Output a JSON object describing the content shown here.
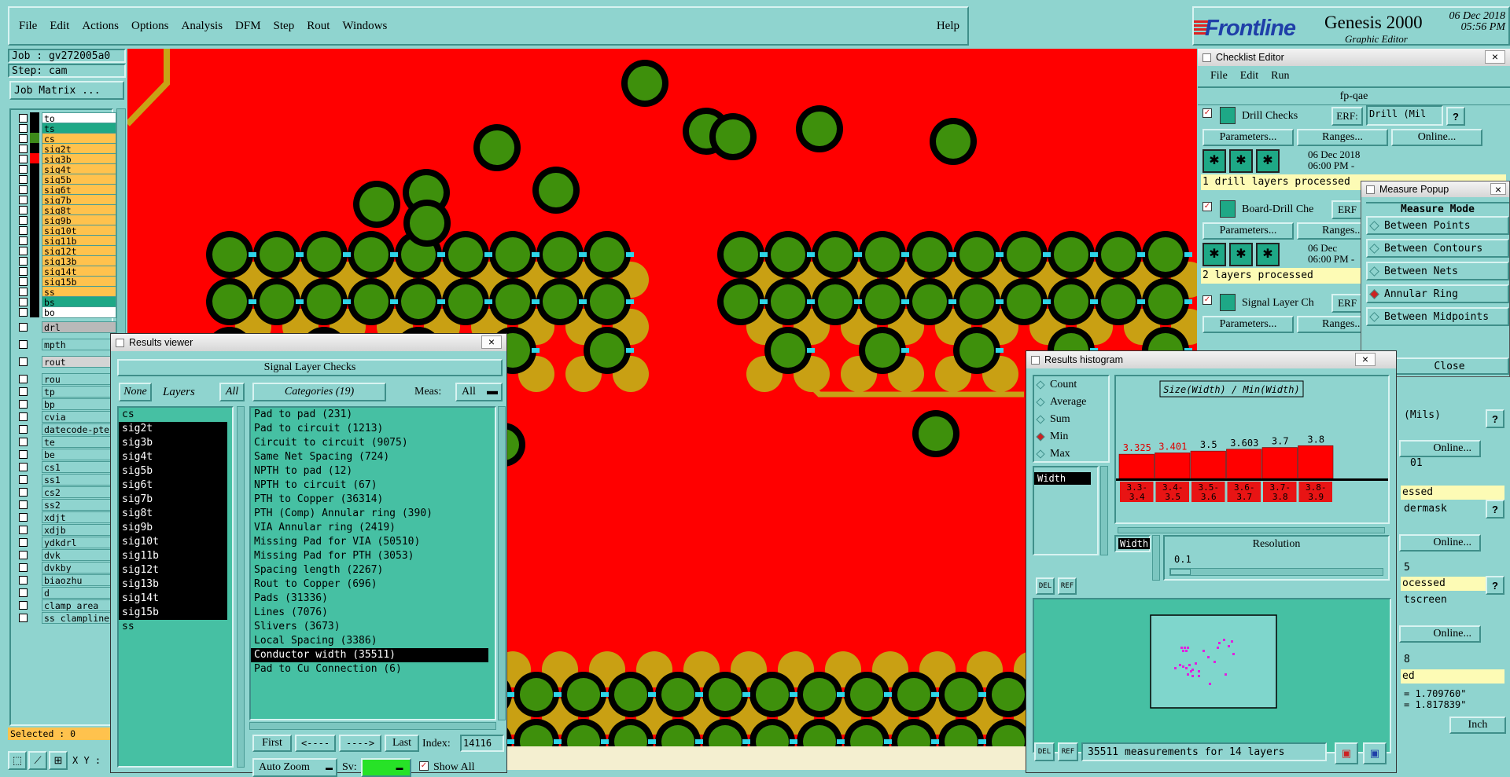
{
  "menubar": {
    "items": [
      "File",
      "Edit",
      "Actions",
      "Options",
      "Analysis",
      "DFM",
      "Step",
      "Rout",
      "Windows"
    ],
    "help": "Help"
  },
  "brand": {
    "logo": "Frontline",
    "product": "Genesis 2000",
    "subtitle": "Graphic Editor",
    "date": "06 Dec 2018",
    "time": "05:56 PM"
  },
  "left": {
    "job": "Job : gv272005a0",
    "step": "Step: cam",
    "job_matrix": "Job Matrix ...",
    "layers": [
      {
        "name": "to",
        "color": "#000000",
        "bg": "#ffffff"
      },
      {
        "name": "ts",
        "color": "#000000",
        "bg": "#1ea886"
      },
      {
        "name": "cs",
        "color": "#3d8a1a",
        "bg": "#ffc24d"
      },
      {
        "name": "sig2t",
        "color": "#000000",
        "bg": "#ffc24d"
      },
      {
        "name": "sig3b",
        "color": "#ff0000",
        "bg": "#ffc24d"
      },
      {
        "name": "sig4t",
        "color": "#000000",
        "bg": "#ffc24d"
      },
      {
        "name": "sig5b",
        "color": "#000000",
        "bg": "#ffc24d"
      },
      {
        "name": "sig6t",
        "color": "#000000",
        "bg": "#ffc24d"
      },
      {
        "name": "sig7b",
        "color": "#000000",
        "bg": "#ffc24d"
      },
      {
        "name": "sig8t",
        "color": "#000000",
        "bg": "#ffc24d"
      },
      {
        "name": "sig9b",
        "color": "#000000",
        "bg": "#ffc24d"
      },
      {
        "name": "sig10t",
        "color": "#000000",
        "bg": "#ffc24d"
      },
      {
        "name": "sig11b",
        "color": "#000000",
        "bg": "#ffc24d"
      },
      {
        "name": "sig12t",
        "color": "#000000",
        "bg": "#ffc24d"
      },
      {
        "name": "sig13b",
        "color": "#000000",
        "bg": "#ffc24d"
      },
      {
        "name": "sig14t",
        "color": "#000000",
        "bg": "#ffc24d"
      },
      {
        "name": "sig15b",
        "color": "#000000",
        "bg": "#ffc24d"
      },
      {
        "name": "ss",
        "color": "#000000",
        "bg": "#ffc24d"
      },
      {
        "name": "bs",
        "color": "#000000",
        "bg": "#1ea886"
      },
      {
        "name": "bo",
        "color": "#000000",
        "bg": "#ffffff"
      }
    ],
    "drill_layers": [
      {
        "name": "drl",
        "bg": "#b9b9b9"
      },
      {
        "name": "mpth",
        "bg": "#8fd4cf"
      }
    ],
    "rout_layers": [
      {
        "name": "rout",
        "bg": "#d4d4d4"
      }
    ],
    "misc_layers": [
      "rou",
      "tp",
      "bp",
      "cvia",
      "datecode-pte",
      "te",
      "be",
      "cs1",
      "ss1",
      "cs2",
      "ss2",
      "xdjt",
      "xdjb",
      "ydkdrl",
      "dvk",
      "dvkby",
      "biaozhu",
      "d",
      "clamp_area",
      "ss_clampline"
    ],
    "selected": "Selected : 0",
    "xy_label": "X Y :"
  },
  "checklist": {
    "title": "Checklist Editor",
    "menu": [
      "File",
      "Edit",
      "Run"
    ],
    "name": "fp-qae",
    "checks": [
      {
        "label": "Drill Checks",
        "erf_label": "ERF:",
        "erf_value": "Drill (Mil",
        "date": "06 Dec 2018",
        "time": "06:00 PM -",
        "status": "1 drill layers processed"
      },
      {
        "label": "Board-Drill Che",
        "erf_label": "ERF",
        "erf_value": "",
        "date": "06 Dec",
        "time": "06:00 PM -",
        "status": "2 layers processed"
      },
      {
        "label": "Signal Layer Ch",
        "erf_label": "ERF",
        "erf_value": "",
        "date": "",
        "time": "",
        "status": ""
      }
    ],
    "params": "Parameters...",
    "ranges": "Ranges...",
    "online": "Online...",
    "help": "?",
    "right_fragments": [
      "(Mils)",
      "Online...",
      "01",
      "essed",
      "dermask",
      "Online...",
      "5",
      "ocessed",
      "tscreen",
      "Online...",
      "8",
      "ed"
    ],
    "coords": {
      "x": "= 1.709760\"",
      "y": "= 1.817839\""
    },
    "units": "Inch"
  },
  "measure": {
    "title": "Measure Popup",
    "header": "Measure Mode",
    "modes": [
      "Between Points",
      "Between Contours",
      "Between Nets",
      "Annular Ring",
      "Between Midpoints"
    ],
    "selected_index": 3,
    "close": "Close"
  },
  "results_viewer": {
    "title": "Results viewer",
    "header": "Signal Layer Checks",
    "none": "None",
    "layers": "Layers",
    "all": "All",
    "categories": "Categories (19)",
    "meas_label": "Meas:",
    "meas_value": "All",
    "layer_list": [
      "cs",
      "sig2t",
      "sig3b",
      "sig4t",
      "sig5b",
      "sig6t",
      "sig7b",
      "sig8t",
      "sig9b",
      "sig10t",
      "sig11b",
      "sig12t",
      "sig13b",
      "sig14t",
      "sig15b",
      "ss"
    ],
    "category_list": [
      "Pad to pad (231)",
      "Pad to circuit (1213)",
      "Circuit to circuit (9075)",
      "Same Net Spacing (724)",
      "NPTH to pad (12)",
      "NPTH to circuit (67)",
      "PTH to Copper (36314)",
      "PTH (Comp) Annular ring (390)",
      "VIA Annular ring (2419)",
      "Missing Pad for VIA (50510)",
      "Missing Pad for PTH (3053)",
      "Spacing length (2267)",
      "Rout to Copper (696)",
      "Pads (31336)",
      "Lines (7076)",
      "Slivers (3673)",
      "Local Spacing (3386)",
      "Conductor width (35511)",
      "Pad to Cu Connection (6)"
    ],
    "selected_category": 17,
    "first": "First",
    "prev": "<----",
    "next": "---->",
    "last": "Last",
    "index_label": "Index:",
    "index_value": "14116",
    "auto_zoom": "Auto Zoom",
    "sv_label": "Sv:",
    "show_all": "Show All"
  },
  "histogram": {
    "title": "Results histogram",
    "stat_options": [
      "Count",
      "Average",
      "Sum",
      "Min",
      "Max"
    ],
    "selected_stat": 3,
    "attr_list": [
      "Width"
    ],
    "attr_label": "Width",
    "chart_title": "Size(Width) / Min(Width)",
    "resolution_label": "Resolution",
    "resolution_value": "0.1",
    "footer": "35511 measurements for 14 layers",
    "del": "DEL",
    "ref": "REF"
  },
  "chart_data": {
    "type": "bar",
    "title": "Size(Width) / Min(Width)",
    "categories": [
      "3.3-3.4",
      "3.4-3.5",
      "3.5-3.6",
      "3.6-3.7",
      "3.7-3.8",
      "3.8-3.9"
    ],
    "values": [
      3.325,
      3.401,
      3.5,
      3.603,
      3.7,
      3.8
    ],
    "value_labels": [
      "3.325",
      "3.401",
      "3.5",
      "3.603",
      "3.7",
      "3.8"
    ],
    "highlighted_value_labels": [
      0,
      1
    ],
    "bar_color": "#ff0000"
  }
}
